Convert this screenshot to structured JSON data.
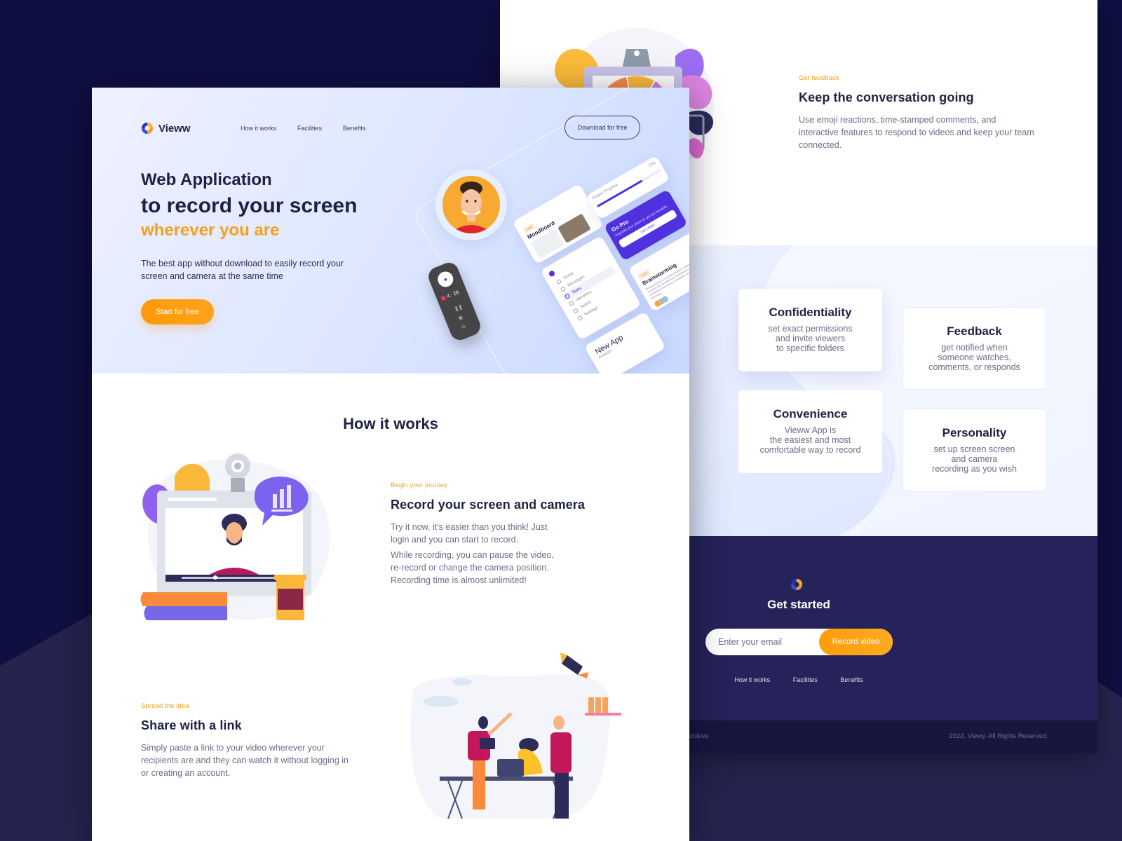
{
  "brand": {
    "name": "Vieww",
    "accent": "#f5a01a",
    "navy": "#1e2142",
    "purple": "#5031e0"
  },
  "nav": {
    "links": [
      "How it works",
      "Facilities",
      "Benefits"
    ],
    "cta": "Download for free"
  },
  "hero": {
    "line1": "Web Application",
    "line2": "to record your screen",
    "line3": "wherever you are",
    "subtitle": "The best app without download to easily record your screen and camera at the same time",
    "cta": "Start for free",
    "recorder": {
      "time": "4 : 28"
    },
    "mock_cards": {
      "moodboard": {
        "tag": "Low",
        "title": "Moodboard"
      },
      "progress": {
        "title": "Project Progress",
        "percent": "72%",
        "value": 0.72
      },
      "gopro": {
        "title": "Go Pro",
        "text": "Upgrade your plans to get pro benefits",
        "button": "Let's Start"
      },
      "menu": [
        "Home",
        "Messages",
        "Tasks",
        "Members",
        "Teams",
        "Settings"
      ],
      "menu_active": "Tasks",
      "brainstorming": {
        "tag": "Low",
        "title": "Brainstorming",
        "text": "Brainstorming is a group problem-solving technique that involves the spontaneous contribution of ideas from all members of the group conducted several brainstorming sessions."
      },
      "newapp": {
        "title": "New App",
        "subtitle": "Analysts"
      }
    }
  },
  "how_it_works": {
    "title": "How it works",
    "steps": [
      {
        "eyebrow": "Begin your journey",
        "title": "Record your screen and camera",
        "paragraphs": [
          "Try it now, it's easier than you think! Just login and you can start to record.",
          "While recording, you can pause the video, re-record or change the camera position. Recording time is almost unlimited!"
        ]
      },
      {
        "eyebrow": "Spread the idea",
        "title": "Share with a link",
        "paragraphs": [
          "Simply paste a link to your video wherever your recipients are and they can watch it without logging in or creating an account."
        ]
      }
    ]
  },
  "feedback": {
    "eyebrow": "Get feedback",
    "title": "Keep the conversation going",
    "body": "Use emoji reactions, time-stamped comments, and interactive features to respond to videos and keep your team connected."
  },
  "benefits": [
    {
      "title": "Confidentiality",
      "desc": "set exact permissions\nand invite viewers\nto specific folders"
    },
    {
      "title": "Feedback",
      "desc": "get notified when\nsomeone watches,\ncomments, or responds"
    },
    {
      "title": "Convenience",
      "desc": "Vieww App is\nthe easiest and most\ncomfortable way to record"
    },
    {
      "title": "Personality",
      "desc": "set up screen screen\nand camera\nrecording as you wish"
    }
  ],
  "get_started": {
    "title": "Get started",
    "email_placeholder": "Enter your email",
    "button": "Record video",
    "links": [
      "How it works",
      "Facilities",
      "Benefits"
    ]
  },
  "footer": {
    "cookies": "e Cookies",
    "copyright": "2022, Viewy. All Rights Reserved."
  }
}
